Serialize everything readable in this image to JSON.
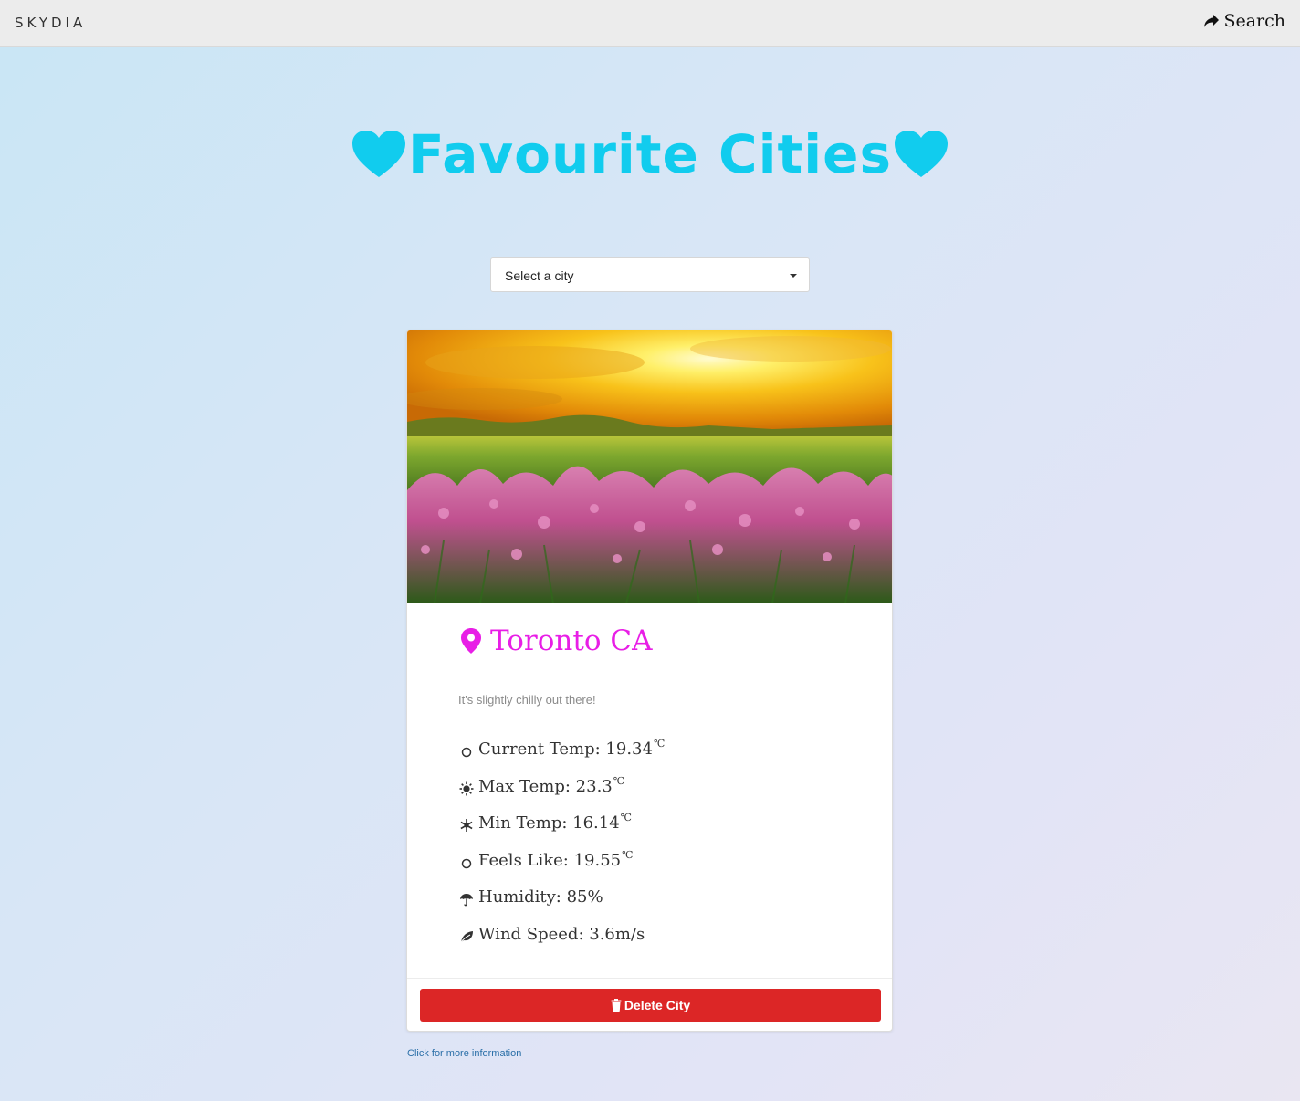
{
  "navbar": {
    "brand": "SKYDIA",
    "search_label": "Search"
  },
  "page": {
    "title": "Favourite Cities",
    "accent_color": "#11ccee"
  },
  "city_select": {
    "selected": "Select a city"
  },
  "card": {
    "image_description": "Field of pink wildflowers under a bright yellow sunset sky",
    "city": "Toronto CA",
    "description": "It's slightly chilly out there!",
    "stats": [
      {
        "icon": "circle-icon",
        "label": "Current Temp: 19.34",
        "unit": "℃"
      },
      {
        "icon": "sun-icon",
        "label": "Max Temp: 23.3",
        "unit": "℃"
      },
      {
        "icon": "snowflake-icon",
        "label": "Min Temp: 16.14",
        "unit": "℃"
      },
      {
        "icon": "circle-icon",
        "label": "Feels Like: 19.55",
        "unit": "℃"
      },
      {
        "icon": "umbrella-icon",
        "label": "Humidity: 85%",
        "unit": ""
      },
      {
        "icon": "leaf-icon",
        "label": "Wind Speed: 3.6m/s",
        "unit": ""
      }
    ],
    "delete_label": "Delete City",
    "city_color": "#e81ee6",
    "delete_color": "#dc2626"
  },
  "footer": {
    "more_info_link": "Click for more information"
  }
}
